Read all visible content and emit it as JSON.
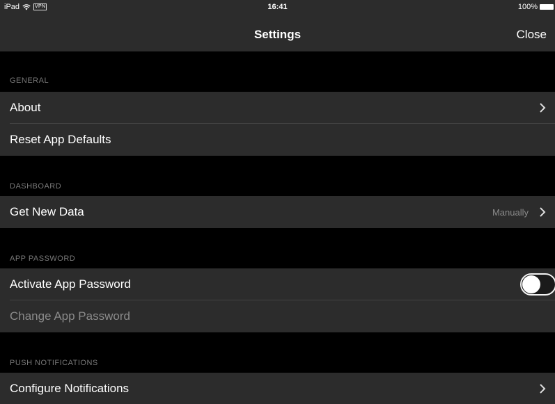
{
  "status_bar": {
    "device": "iPad",
    "vpn": "VPN",
    "time": "16:41",
    "battery": "100%"
  },
  "nav": {
    "title": "Settings",
    "close_label": "Close"
  },
  "sections": {
    "general": {
      "header": "GENERAL",
      "about": "About",
      "reset": "Reset App Defaults"
    },
    "dashboard": {
      "header": "DASHBOARD",
      "get_new_data": "Get New Data",
      "get_new_data_value": "Manually"
    },
    "app_password": {
      "header": "APP PASSWORD",
      "activate": "Activate App Password",
      "activate_on": false,
      "change": "Change App Password"
    },
    "push": {
      "header": "PUSH NOTIFICATIONS",
      "configure": "Configure Notifications"
    }
  },
  "icons": {
    "wifi": "wifi-icon",
    "battery": "battery-icon",
    "chevron": "chevron-right-icon"
  },
  "colors": {
    "background": "#000000",
    "cell": "#2c2c2c",
    "header_text": "#7a7a7a",
    "disabled_text": "#8a8a8a"
  }
}
